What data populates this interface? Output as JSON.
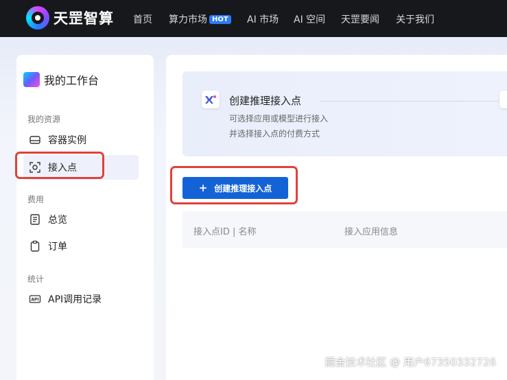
{
  "brand": {
    "name": "天罡智算"
  },
  "nav": {
    "items": [
      {
        "label": "首页"
      },
      {
        "label": "算力市场",
        "badge": "HOT"
      },
      {
        "label": "AI 市场"
      },
      {
        "label": "AI 空间"
      },
      {
        "label": "天罡要闻"
      },
      {
        "label": "关于我们"
      }
    ]
  },
  "sidebar": {
    "workspace_title": "我的工作台",
    "sections": [
      {
        "label": "我的资源",
        "items": [
          {
            "label": "容器实例",
            "icon": "drive-icon"
          },
          {
            "label": "接入点",
            "icon": "scan-icon",
            "active": true
          }
        ]
      },
      {
        "label": "费用",
        "items": [
          {
            "label": "总览",
            "icon": "document-icon"
          },
          {
            "label": "订单",
            "icon": "clipboard-icon"
          }
        ]
      },
      {
        "label": "统计",
        "items": [
          {
            "label": "API调用记录",
            "icon": "api-icon"
          }
        ]
      }
    ]
  },
  "main": {
    "hero": {
      "title": "创建推理接入点",
      "subtitle_1": "可选择应用或模型进行接入",
      "subtitle_2": "并选择接入点的付费方式"
    },
    "create_button": {
      "label": "创建推理接入点",
      "icon": "plus-icon"
    },
    "table": {
      "columns": [
        "接入点ID | 名称",
        "接入应用信息"
      ]
    }
  },
  "watermark": "掘金技术社区 @ 用户67350332726",
  "colors": {
    "topbar": "#17181c",
    "primary": "#1463d6",
    "highlight": "#e0413b",
    "hot_badge": "#2a7bf6"
  }
}
